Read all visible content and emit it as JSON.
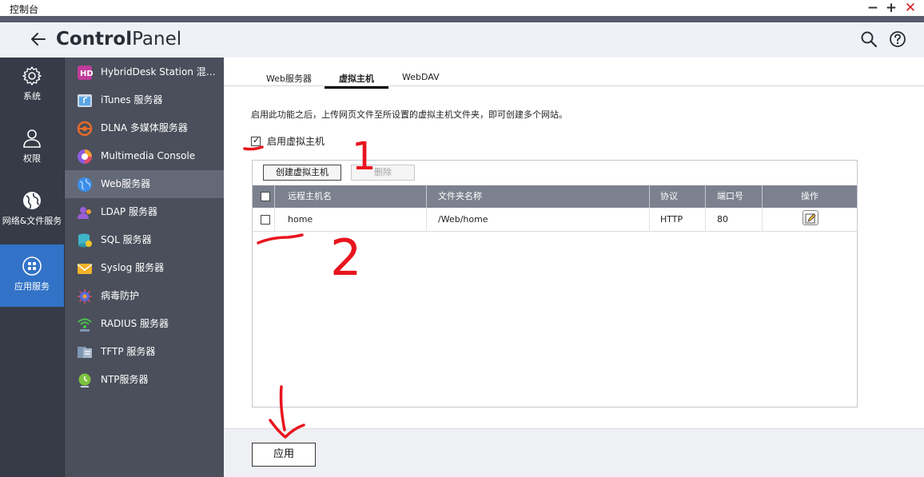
{
  "window": {
    "title": "控制台"
  },
  "header": {
    "brand_bold": "Control",
    "brand_rest": "Panel"
  },
  "col1": [
    {
      "label": "系统",
      "icon": "gear-icon"
    },
    {
      "label": "权限",
      "icon": "user-icon"
    },
    {
      "label": "网络&文件服务",
      "icon": "globe-icon"
    },
    {
      "label": "应用服务",
      "icon": "apps-grid-icon",
      "active": true
    }
  ],
  "col2": [
    {
      "label": "HybridDesk Station 混合桌面",
      "icon": "hd-station-icon",
      "color": "#c03b9a"
    },
    {
      "label": "iTunes 服务器",
      "icon": "itunes-icon",
      "color": "#5aa6e8"
    },
    {
      "label": "DLNA 多媒体服务器",
      "icon": "dlna-icon",
      "color": "#e86a2a"
    },
    {
      "label": "Multimedia Console",
      "icon": "multimedia-icon",
      "color": "#8e5be0"
    },
    {
      "label": "Web服务器",
      "icon": "web-globe-icon",
      "color": "#3c8ee8",
      "active": true
    },
    {
      "label": "LDAP 服务器",
      "icon": "ldap-icon",
      "color": "#9a5ed6"
    },
    {
      "label": "SQL 服务器",
      "icon": "sql-icon",
      "color": "#3fb6c8"
    },
    {
      "label": "Syslog 服务器",
      "icon": "syslog-icon",
      "color": "#f3b32a"
    },
    {
      "label": "病毒防护",
      "icon": "antivirus-icon",
      "color": "#5d6ad8"
    },
    {
      "label": "RADIUS 服务器",
      "icon": "radius-icon",
      "color": "#4ec24e"
    },
    {
      "label": "TFTP 服务器",
      "icon": "tftp-icon",
      "color": "#7f97b2"
    },
    {
      "label": "NTP服务器",
      "icon": "ntp-icon",
      "color": "#7dc23e"
    }
  ],
  "tabs": [
    {
      "label": "Web服务器"
    },
    {
      "label": "虚拟主机",
      "active": true
    },
    {
      "label": "WebDAV"
    }
  ],
  "description": "启用此功能之后，上传网页文件至所设置的虚拟主机文件夹，即可创建多个网站。",
  "enable_label": "启用虚拟主机",
  "buttons": {
    "create": "创建虚拟主机",
    "delete": "删除",
    "apply": "应用"
  },
  "table": {
    "headers": [
      "远程主机名",
      "文件夹名称",
      "协议",
      "端口号",
      "操作"
    ],
    "rows": [
      {
        "host": "home",
        "folder": "/Web/home",
        "protocol": "HTTP",
        "port": "80"
      }
    ]
  },
  "annotations": [
    "1",
    "2"
  ],
  "colors": {
    "sidebar_dark": "#363b47",
    "sidebar_active": "#3273c7",
    "accent_red": "#e8141e"
  }
}
